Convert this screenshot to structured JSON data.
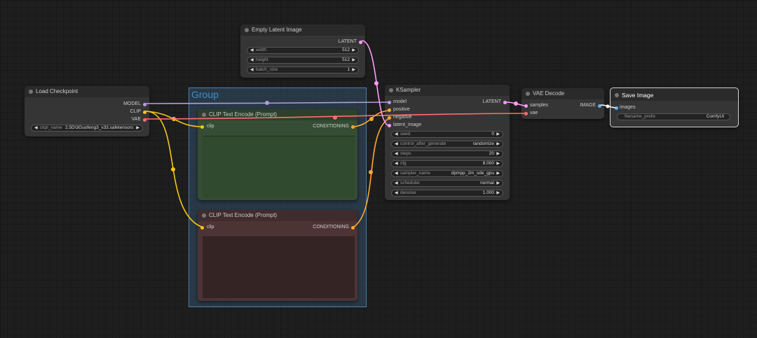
{
  "group": {
    "title": "Group"
  },
  "empty_latent": {
    "title": "Empty Latent Image",
    "output": "LATENT",
    "widgets": [
      {
        "label": "width",
        "value": "512"
      },
      {
        "label": "height",
        "value": "512"
      },
      {
        "label": "batch_size",
        "value": "1"
      }
    ]
  },
  "load_checkpoint": {
    "title": "Load Checkpoint",
    "outputs": [
      "MODEL",
      "CLIP",
      "VAE"
    ],
    "widget": {
      "label": "ckpt_name",
      "value": "2.5D\\3Guofeng3_v33.safetensors"
    }
  },
  "clip_pos": {
    "title": "CLIP Text Encode (Prompt)",
    "input": "clip",
    "output": "CONDITIONING"
  },
  "clip_neg": {
    "title": "CLIP Text Encode (Prompt)",
    "input": "clip",
    "output": "CONDITIONING"
  },
  "ksampler": {
    "title": "KSampler",
    "inputs": [
      "model",
      "positive",
      "negative",
      "latent_image"
    ],
    "output": "LATENT",
    "widgets": [
      {
        "label": "seed",
        "value": "0"
      },
      {
        "label": "control_after_generate",
        "value": "randomize"
      },
      {
        "label": "steps",
        "value": "20"
      },
      {
        "label": "cfg",
        "value": "8.000"
      },
      {
        "label": "sampler_name",
        "value": "dpmpp_2m_sde_gpu"
      },
      {
        "label": "scheduler",
        "value": "normal"
      },
      {
        "label": "denoise",
        "value": "1.000"
      }
    ]
  },
  "vae_decode": {
    "title": "VAE Decode",
    "inputs": [
      "samples",
      "vae"
    ],
    "output": "IMAGE"
  },
  "save_image": {
    "title": "Save Image",
    "input": "images",
    "widget": {
      "label": "filename_prefix",
      "value": "ComfyUI"
    }
  },
  "colors": {
    "model": "#b39ddb",
    "clip": "#f5c518",
    "vae": "#ff6e6e",
    "latent": "#ff9cf9",
    "conditioning": "#ffa931",
    "image": "#64b5f6",
    "pos_node": "#2f4a2f",
    "neg_node": "#4a2f2f"
  }
}
